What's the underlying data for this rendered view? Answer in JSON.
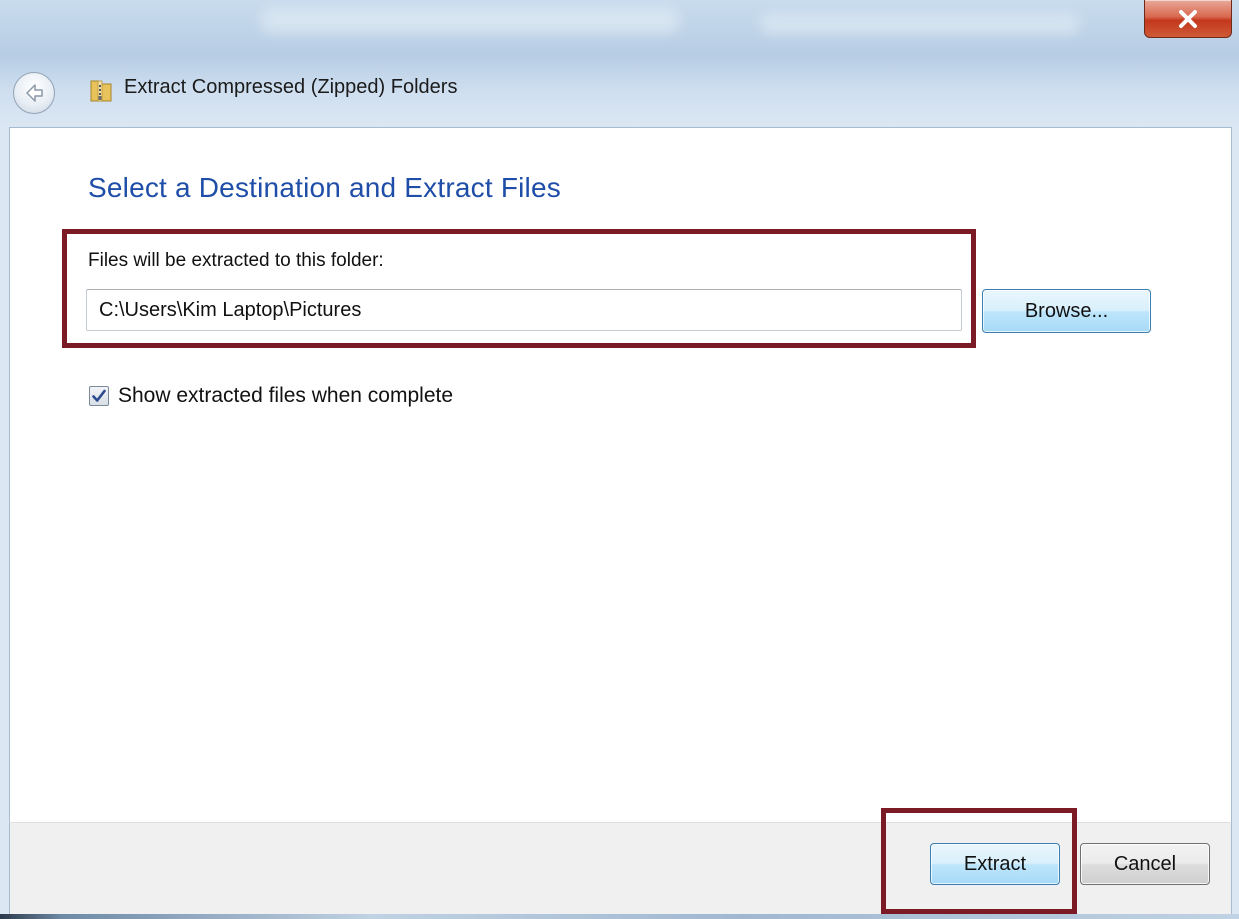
{
  "window": {
    "title": "Extract Compressed (Zipped) Folders"
  },
  "icons": {
    "close": "close-icon",
    "back": "back-arrow-icon",
    "folder": "zipped-folder-icon",
    "check": "checkmark-icon"
  },
  "main": {
    "instruction": "Select a Destination and Extract Files",
    "destination_label": "Files will be extracted to this folder:",
    "destination_path": "C:\\Users\\Kim Laptop\\Pictures",
    "browse_label": "Browse...",
    "show_files_label": "Show extracted files when complete",
    "show_files_checked": true
  },
  "footer": {
    "extract_label": "Extract",
    "cancel_label": "Cancel"
  },
  "colors": {
    "instruction": "#1f4ea8",
    "highlight": "#7a1b25",
    "close_button": "#c3381c"
  }
}
